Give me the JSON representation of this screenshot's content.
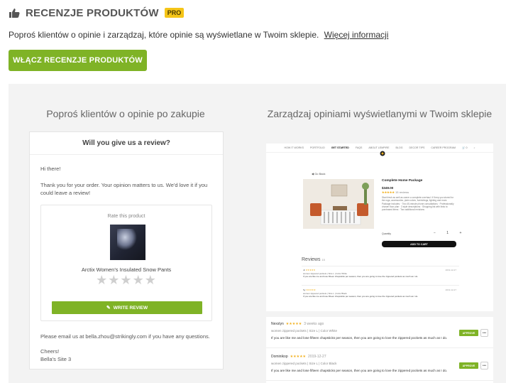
{
  "header": {
    "icon": "thumbs-up-icon",
    "title": "RECENZJE PRODUKTÓW",
    "badge": "PRO"
  },
  "description": {
    "text": "Poproś klientów o opinie i zarządzaj, które opinie są wyświetlane w Twoim sklepie.",
    "link": "Więcej informacji"
  },
  "enable_button": "WŁĄCZ RECENZJE PRODUKTÓW",
  "left_column": {
    "title": "Poproś klientów o opinie po zakupie",
    "email": {
      "heading": "Will you give us a review?",
      "greeting": "Hi there!",
      "thanks": "Thank you for your order. Your opinion matters to us. We'd love it if you could leave a review!",
      "rate_label": "Rate this product",
      "product_name": "Arctix Women's Insulated Snow Pants",
      "stars": "★★★★★",
      "write_review": "WRITE REVIEW",
      "questions": "Please email us at bella.zhou@strikingly.com if you have any questions.",
      "cheers": "Cheers!",
      "signature": "Bella's Site 3"
    }
  },
  "right_column": {
    "title": "Zarządzaj opiniami wyświetlanymi w Twoim sklepie",
    "shop": {
      "nav": [
        "HOW IT WORKS",
        "PORTFOLIO",
        "GET STARTED",
        "FAQS",
        "ABOUT LEMPIRE",
        "BLOG",
        "DECOR TIPS",
        "CAREER PROGRAM",
        "🛒 0",
        "⌕"
      ],
      "back": "◀ Go Back",
      "product_title": "Complete Home Package",
      "price": "$349.00",
      "rating": "★★★★★",
      "rating_count": "15 reviews",
      "description": "Start fresh as well as owner a complete overhaul. If Keep you stored for the rugs, accessories, plain colors, furnishings, lighting and more. Package includes: · Two 45-minute phone consultations · Professionally chosen floor plan · 3 style descriptions · Shopping list with links to purchased items · Two additional revisions",
      "quantity_label": "Quantity",
      "quantity": "− 1 +",
      "cart_button": "ADD TO CART",
      "reviews_heading": "Reviews",
      "reviews_count": "15",
      "mini_reviews": [
        {
          "name": "Jc",
          "stars": "★★★★★",
          "meta": "women zippered pockets  |  Size L  |  Color White",
          "date": "2019-12-27",
          "text": "If you are like me and lose fifteen chapsticks per season, then you are going to love the zippered pockets as much as I do."
        },
        {
          "name": "Sy",
          "stars": "★★★★★",
          "meta": "women zippered pockets  |  Size L  |  Color Black",
          "date": "2019-12-27",
          "text": "If you are like me and lose fifteen chapsticks per season, then you are going to love the zippered pockets as much as I do."
        }
      ]
    },
    "admin_reviews": [
      {
        "name": "Nexslyn",
        "stars": "★★★★★",
        "date": "3 weeks ago",
        "meta": "women zippered pockets  |  Size L  |  Color White",
        "text": "If you are like me and lose fifteen chapsticks per season, then you are going to love the zippered pockets as much as I do.",
        "approve": "APPROVE",
        "more": "•••"
      },
      {
        "name": "Dominikop",
        "stars": "★★★★★",
        "date": "2019-12-27",
        "meta": "women zippered pockets  |  Size L  |  Color Black",
        "text": "If you are like me and lose fifteen chapsticks per season, then you are going to love the zippered pockets as much as I do.",
        "approve": "APPROVE",
        "more": "•••"
      }
    ]
  },
  "colors": {
    "accent_green": "#7fb326",
    "pro_badge": "#f5c518",
    "star_gold": "#f2b01e",
    "panel_bg": "#f3f3f3"
  }
}
